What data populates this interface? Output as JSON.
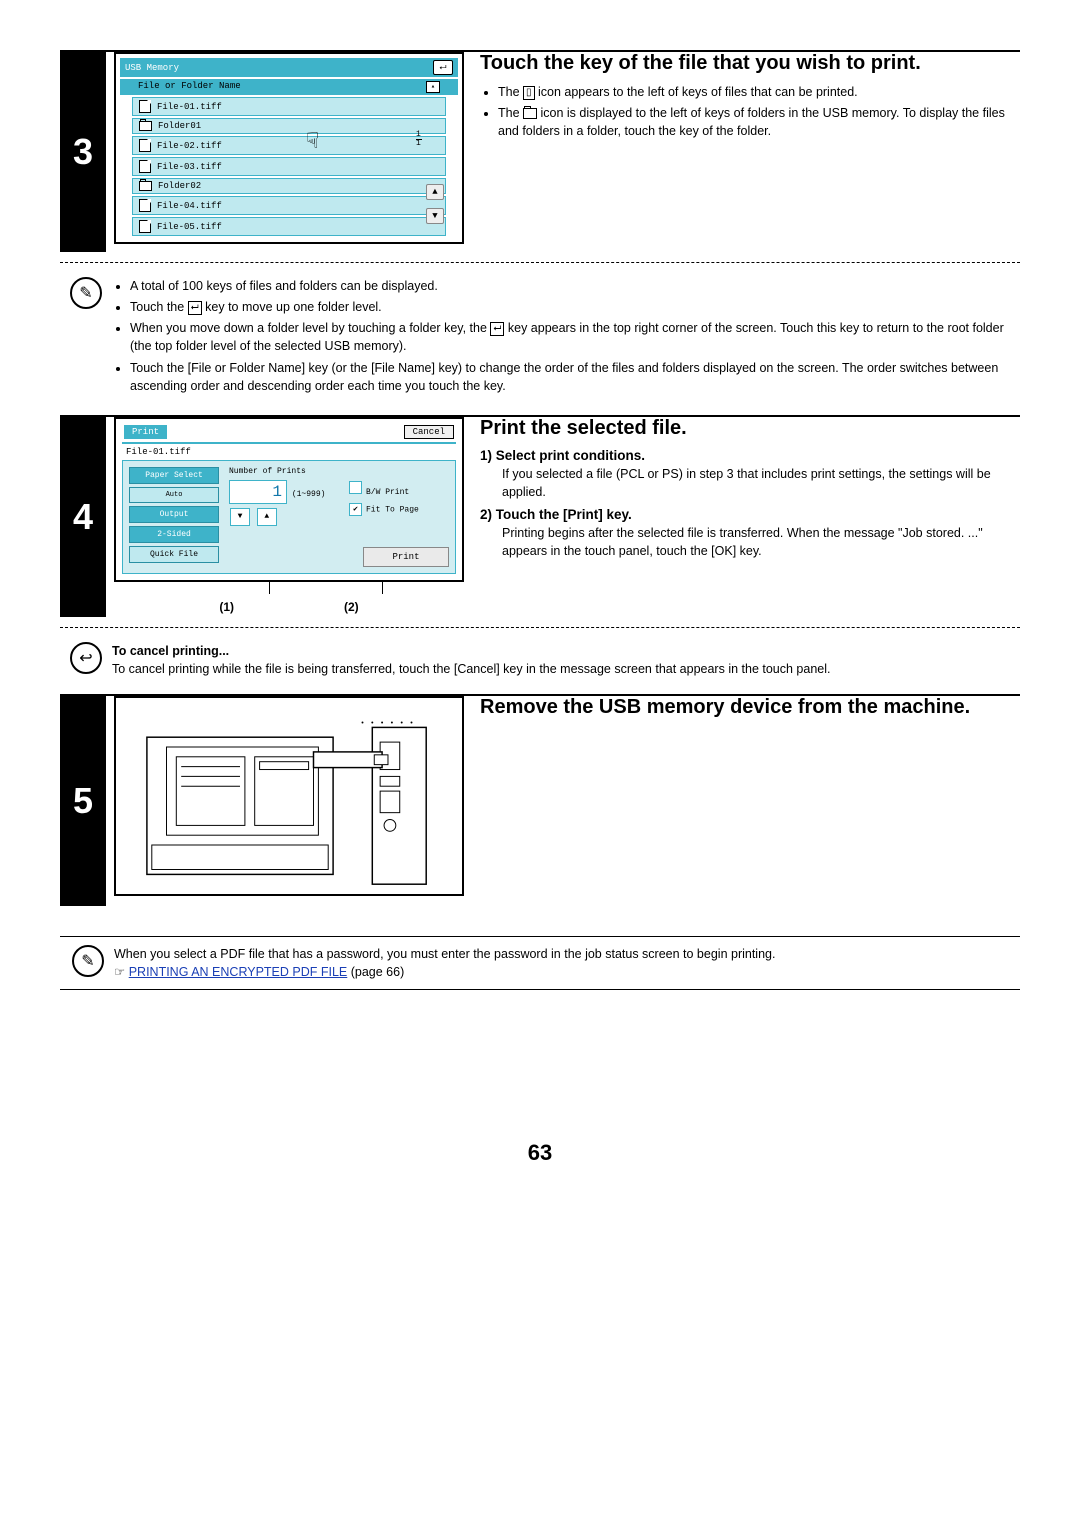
{
  "page_number": "63",
  "step3": {
    "number": "3",
    "title": "Touch the key of the file that you wish to print.",
    "bullets": [
      "The        icon appears to the left of keys of files that can be printed.",
      "The        icon is displayed to the left of keys of folders in the USB memory. To display the files and folders in a folder, touch the key of the folder."
    ],
    "panel": {
      "title": "USB Memory",
      "header": "File or Folder Name",
      "items": [
        {
          "type": "file",
          "name": "File-01.tiff"
        },
        {
          "type": "folder",
          "name": "Folder01"
        },
        {
          "type": "file",
          "name": "File-02.tiff"
        },
        {
          "type": "file",
          "name": "File-03.tiff"
        },
        {
          "type": "folder",
          "name": "Folder02"
        },
        {
          "type": "file",
          "name": "File-04.tiff"
        },
        {
          "type": "file",
          "name": "File-05.tiff"
        }
      ],
      "page_indicator_top": "1",
      "page_indicator_bottom": "1"
    },
    "notes": [
      "A total of 100 keys of files and folders can be displayed.",
      "Touch the         key to move up one folder level.",
      "When you move down a folder level by touching a folder key, the         key appears in the top right corner of the screen. Touch this key to return to the root folder (the top folder level of the selected USB memory).",
      "Touch the [File or Folder Name] key (or the [File Name] key) to change the order of the files and folders displayed on the screen. The order switches between ascending order and descending order each time you touch the key."
    ]
  },
  "step4": {
    "number": "4",
    "title": "Print the selected file.",
    "sub1_h": "1)  Select print conditions.",
    "sub1_b": "If you selected a file (PCL or PS) in step 3 that includes print settings, the settings will be applied.",
    "sub2_h": "2)  Touch the [Print] key.",
    "sub2_b": "Printing begins after the selected file is transferred. When the message \"Job stored. ...\" appears in the touch panel, touch the [OK] key.",
    "panel": {
      "title": "Print",
      "cancel": "Cancel",
      "filename": "File-01.tiff",
      "paper_select": "Paper Select",
      "auto": "Auto",
      "output": "Output",
      "two_sided": "2-Sided",
      "quick_file": "Quick File",
      "num_prints_label": "Number of Prints",
      "num_value": "1",
      "range": "(1~999)",
      "bw": "B/W Print",
      "fit": "Fit To Page",
      "print_btn": "Print"
    },
    "callout1": "(1)",
    "callout2": "(2)",
    "cancel_h": "To cancel printing...",
    "cancel_b": "To cancel printing while the file is being transferred, touch the [Cancel] key in the message screen that appears in the touch panel."
  },
  "step5": {
    "number": "5",
    "title": "Remove the USB memory device from the machine."
  },
  "footer": {
    "text": "When you select a PDF file that has a password, you must enter the password in the job status screen to begin printing.",
    "pointer": "☞",
    "link": "PRINTING AN ENCRYPTED PDF FILE",
    "link_suffix": " (page 66)"
  }
}
